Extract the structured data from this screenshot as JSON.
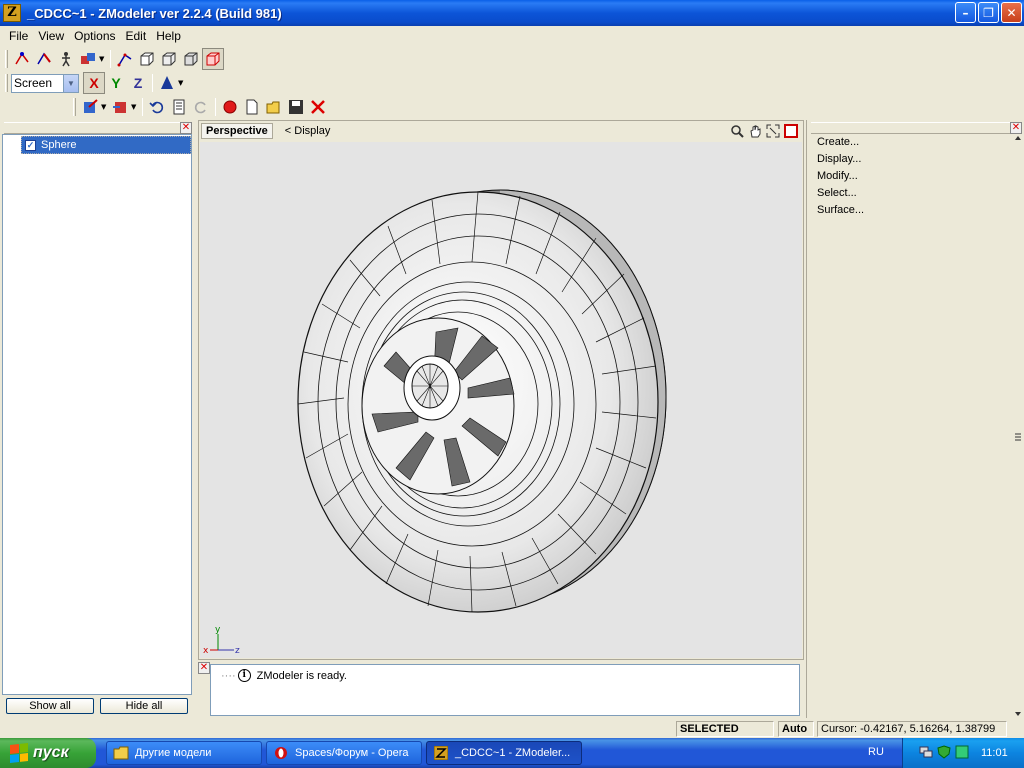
{
  "window": {
    "title": "_CDCC~1 - ZModeler ver 2.2.4 (Build 981)",
    "app_icon_letter": "Z",
    "minimize_glyph": "–",
    "maximize_glyph": "❐",
    "close_glyph": "✕"
  },
  "menu": [
    {
      "label": "File"
    },
    {
      "label": "View"
    },
    {
      "label": "Options"
    },
    {
      "label": "Edit"
    },
    {
      "label": "Help"
    }
  ],
  "toolbar2": {
    "view_select_value": "Screen",
    "axis_x": "X",
    "axis_y": "Y",
    "axis_z": "Z"
  },
  "left_panel": {
    "tree_items": [
      {
        "label": "Sphere",
        "checked": true
      }
    ],
    "show_all_label": "Show all",
    "hide_all_label": "Hide all"
  },
  "viewport": {
    "view_name": "Perspective",
    "display_label": "<  Display",
    "axis_labels": {
      "x": "x",
      "y": "y",
      "z": "z"
    }
  },
  "log": {
    "messages": [
      "ZModeler is ready."
    ]
  },
  "right_panel": {
    "items": [
      "Create...",
      "Display...",
      "Modify...",
      "Select...",
      "Surface..."
    ]
  },
  "status": {
    "mode": "SELECTED MODE",
    "auto": "Auto",
    "cursor": "Cursor: -0.42167, 5.16264, 1.38799"
  },
  "taskbar": {
    "start_label": "пуск",
    "tasks": [
      {
        "label": "Другие модели",
        "icon": "folder-icon"
      },
      {
        "label": "Spaces/Форум - Opera",
        "icon": "opera-icon"
      },
      {
        "label": "_CDCC~1 - ZModeler...",
        "icon": "zmodeler-icon"
      }
    ],
    "language": "RU",
    "clock": "11:01"
  },
  "colors": {
    "title_blue": "#0c55d8",
    "selection": "#316ac5",
    "viewport_bg": "#e4e4e4"
  }
}
